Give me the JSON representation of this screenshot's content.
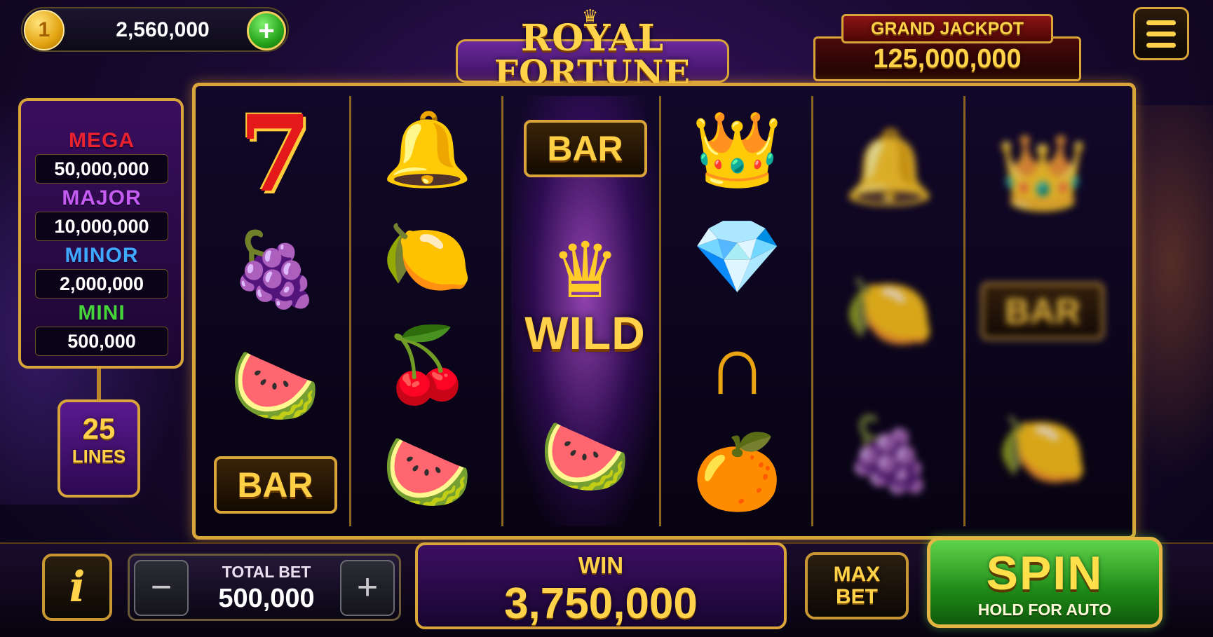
{
  "balance": {
    "value": "2,560,000",
    "coin_symbol": "1",
    "add_symbol": "+"
  },
  "logo": {
    "line1": "ROYAL",
    "line2": "FORTUNE",
    "crown_icon": "crown-icon"
  },
  "grand_jackpot": {
    "label": "GRAND JACKPOT",
    "value": "125,000,000"
  },
  "menu": {
    "icon": "menu-icon"
  },
  "jackpots": [
    {
      "label": "MEGA",
      "value": "50,000,000",
      "color": "#e8232f"
    },
    {
      "label": "MAJOR",
      "value": "10,000,000",
      "color": "#c55cf2"
    },
    {
      "label": "MINOR",
      "value": "2,000,000",
      "color": "#3fa8ff"
    },
    {
      "label": "MINI",
      "value": "500,000",
      "color": "#45d43a"
    }
  ],
  "lines": {
    "count": "25",
    "label": "LINES"
  },
  "reels": [
    {
      "symbols": [
        "seven",
        "grapes",
        "watermelon",
        "bar"
      ],
      "spinning": false
    },
    {
      "symbols": [
        "bell",
        "lemon",
        "cherries",
        "watermelon"
      ],
      "spinning": false
    },
    {
      "symbols": [
        "bar",
        "wild",
        "watermelon"
      ],
      "spinning": false,
      "highlight": true
    },
    {
      "symbols": [
        "crown",
        "diamond",
        "horseshoe",
        "orange"
      ],
      "spinning": false
    },
    {
      "symbols": [
        "bell",
        "lemon",
        "grapes"
      ],
      "spinning": true
    },
    {
      "symbols": [
        "crown",
        "bar",
        "lemon"
      ],
      "spinning": true
    }
  ],
  "symbols_text": {
    "bar": "BAR",
    "wild": "WILD",
    "seven": "7"
  },
  "bet": {
    "label": "TOTAL BET",
    "value": "500,000",
    "minus": "−",
    "plus": "+"
  },
  "win": {
    "label": "WIN",
    "value": "3,750,000"
  },
  "info": {
    "label": "i"
  },
  "max_bet": {
    "line1": "MAX",
    "line2": "BET"
  },
  "spin": {
    "label": "SPIN",
    "sub": "HOLD FOR AUTO"
  },
  "colors": {
    "gold": "#d9a53a",
    "purple": "#3a0e5e",
    "green": "#1f8a18"
  }
}
